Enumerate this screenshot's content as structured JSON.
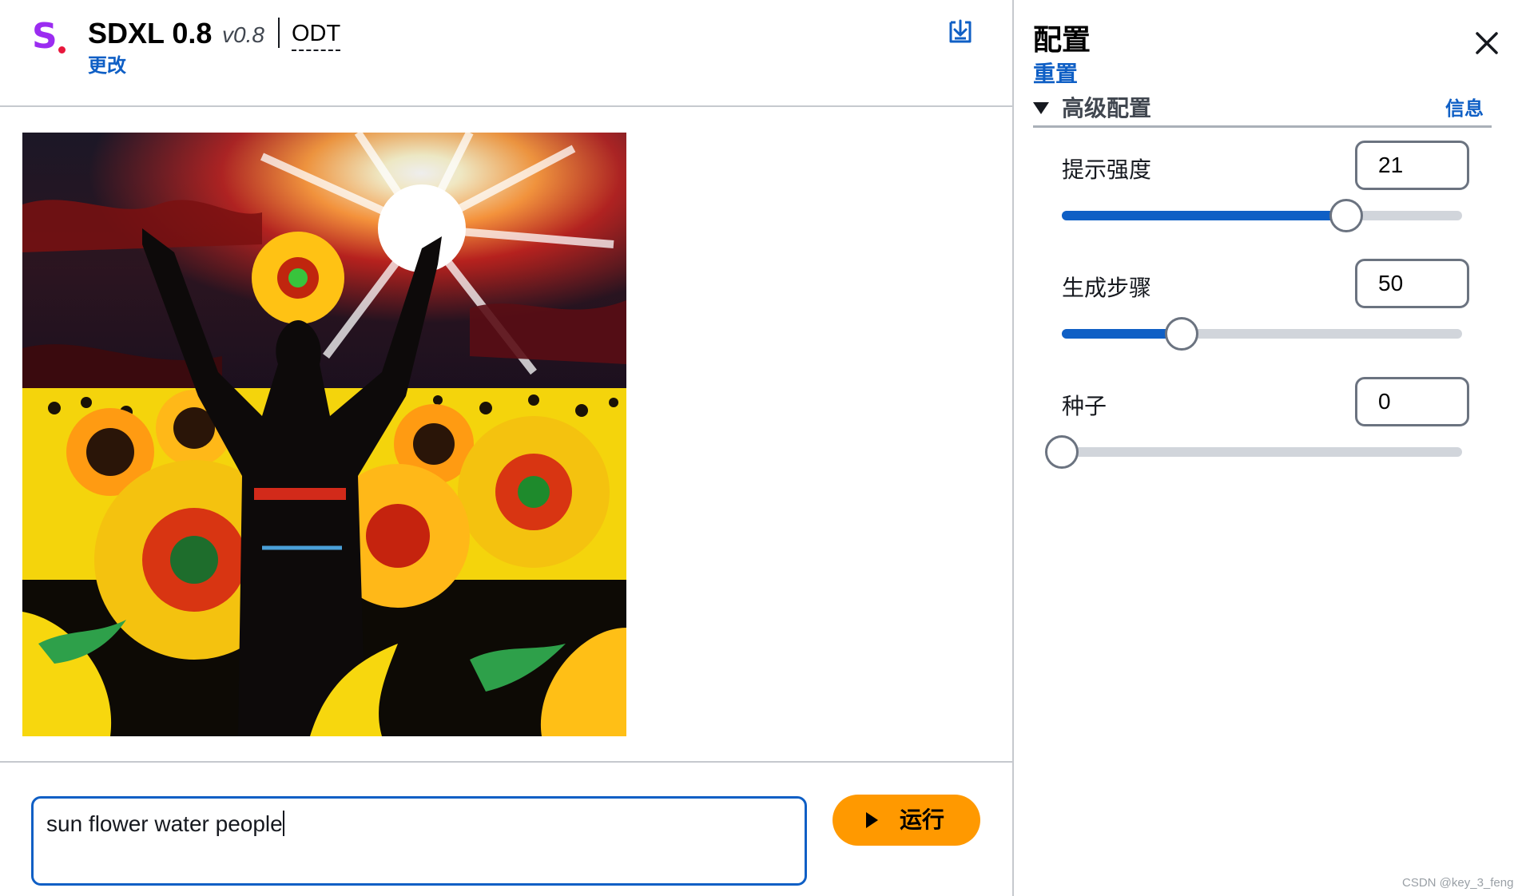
{
  "header": {
    "logo_icon": "s-logo-icon",
    "model_name": "SDXL 0.8",
    "model_version": "v0.8",
    "badge": "ODT",
    "change_link": "更改",
    "download_icon": "download-icon"
  },
  "image": {
    "icon": "generated-image"
  },
  "prompt": {
    "value": "sun flower water people"
  },
  "run_button": {
    "label": "运行",
    "icon": "play-icon",
    "color": "#ff9900"
  },
  "panel": {
    "title": "配置",
    "reset_link": "重置",
    "close_icon": "close-icon",
    "advanced": {
      "label": "高级配置",
      "info_link": "信息",
      "expanded": true,
      "caret_icon": "caret-down-icon"
    },
    "params": [
      {
        "label": "提示强度",
        "value": "21",
        "level": 0.71
      },
      {
        "label": "生成步骤",
        "value": "50",
        "level": 0.3
      },
      {
        "label": "种子",
        "value": "0",
        "level": 0.0
      }
    ]
  },
  "colors": {
    "accent": "#0f5fc5",
    "run": "#ff9900",
    "logo": "#9b2cf1",
    "logo_dot": "#e8173c"
  },
  "watermark": "CSDN @key_3_feng"
}
